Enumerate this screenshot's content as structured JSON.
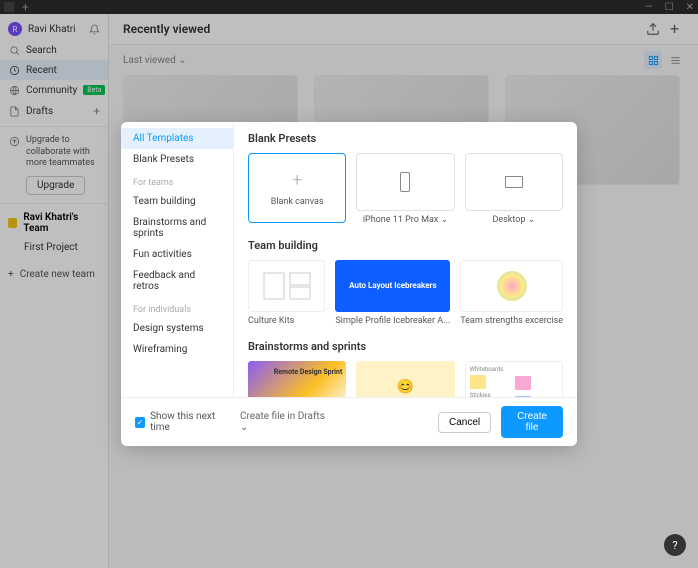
{
  "user": {
    "name": "Ravi Khatri",
    "initial": "R"
  },
  "sidebar": {
    "search": "Search",
    "recent": "Recent",
    "community": "Community",
    "community_badge": "Beta",
    "drafts": "Drafts",
    "upgrade_text": "Upgrade to collaborate with more teammates",
    "upgrade_btn": "Upgrade",
    "team_name": "Ravi Khatri's Team",
    "first_project": "First Project",
    "create_team": "Create new team"
  },
  "main": {
    "title": "Recently viewed",
    "sort": "Last viewed"
  },
  "modal": {
    "nav": {
      "all_templates": "All Templates",
      "blank_presets": "Blank Presets",
      "for_teams": "For teams",
      "team_building": "Team building",
      "brainstorms": "Brainstorms and sprints",
      "fun": "Fun activities",
      "feedback": "Feedback and retros",
      "for_individuals": "For individuals",
      "design_systems": "Design systems",
      "wireframing": "Wireframing"
    },
    "sections": {
      "blank_presets": {
        "title": "Blank Presets",
        "items": [
          {
            "label": "Blank canvas"
          },
          {
            "label": "iPhone 11 Pro Max"
          },
          {
            "label": "Desktop"
          }
        ]
      },
      "team_building": {
        "title": "Team building",
        "items": [
          {
            "label": "Culture Kits"
          },
          {
            "label": "Simple Profile Icebreaker A...",
            "thumb_text": "Auto Layout Icebreakers"
          },
          {
            "label": "Team strengths excercise"
          }
        ]
      },
      "brainstorms": {
        "title": "Brainstorms and sprints",
        "thumb1_text": "Remote Design Sprint",
        "thumb3_labels": {
          "wb": "Whiteboards",
          "st": "Stickies"
        }
      }
    },
    "footer": {
      "show_next": "Show this next time",
      "location": "Create file in Drafts",
      "cancel": "Cancel",
      "create": "Create file"
    }
  },
  "help": "?"
}
